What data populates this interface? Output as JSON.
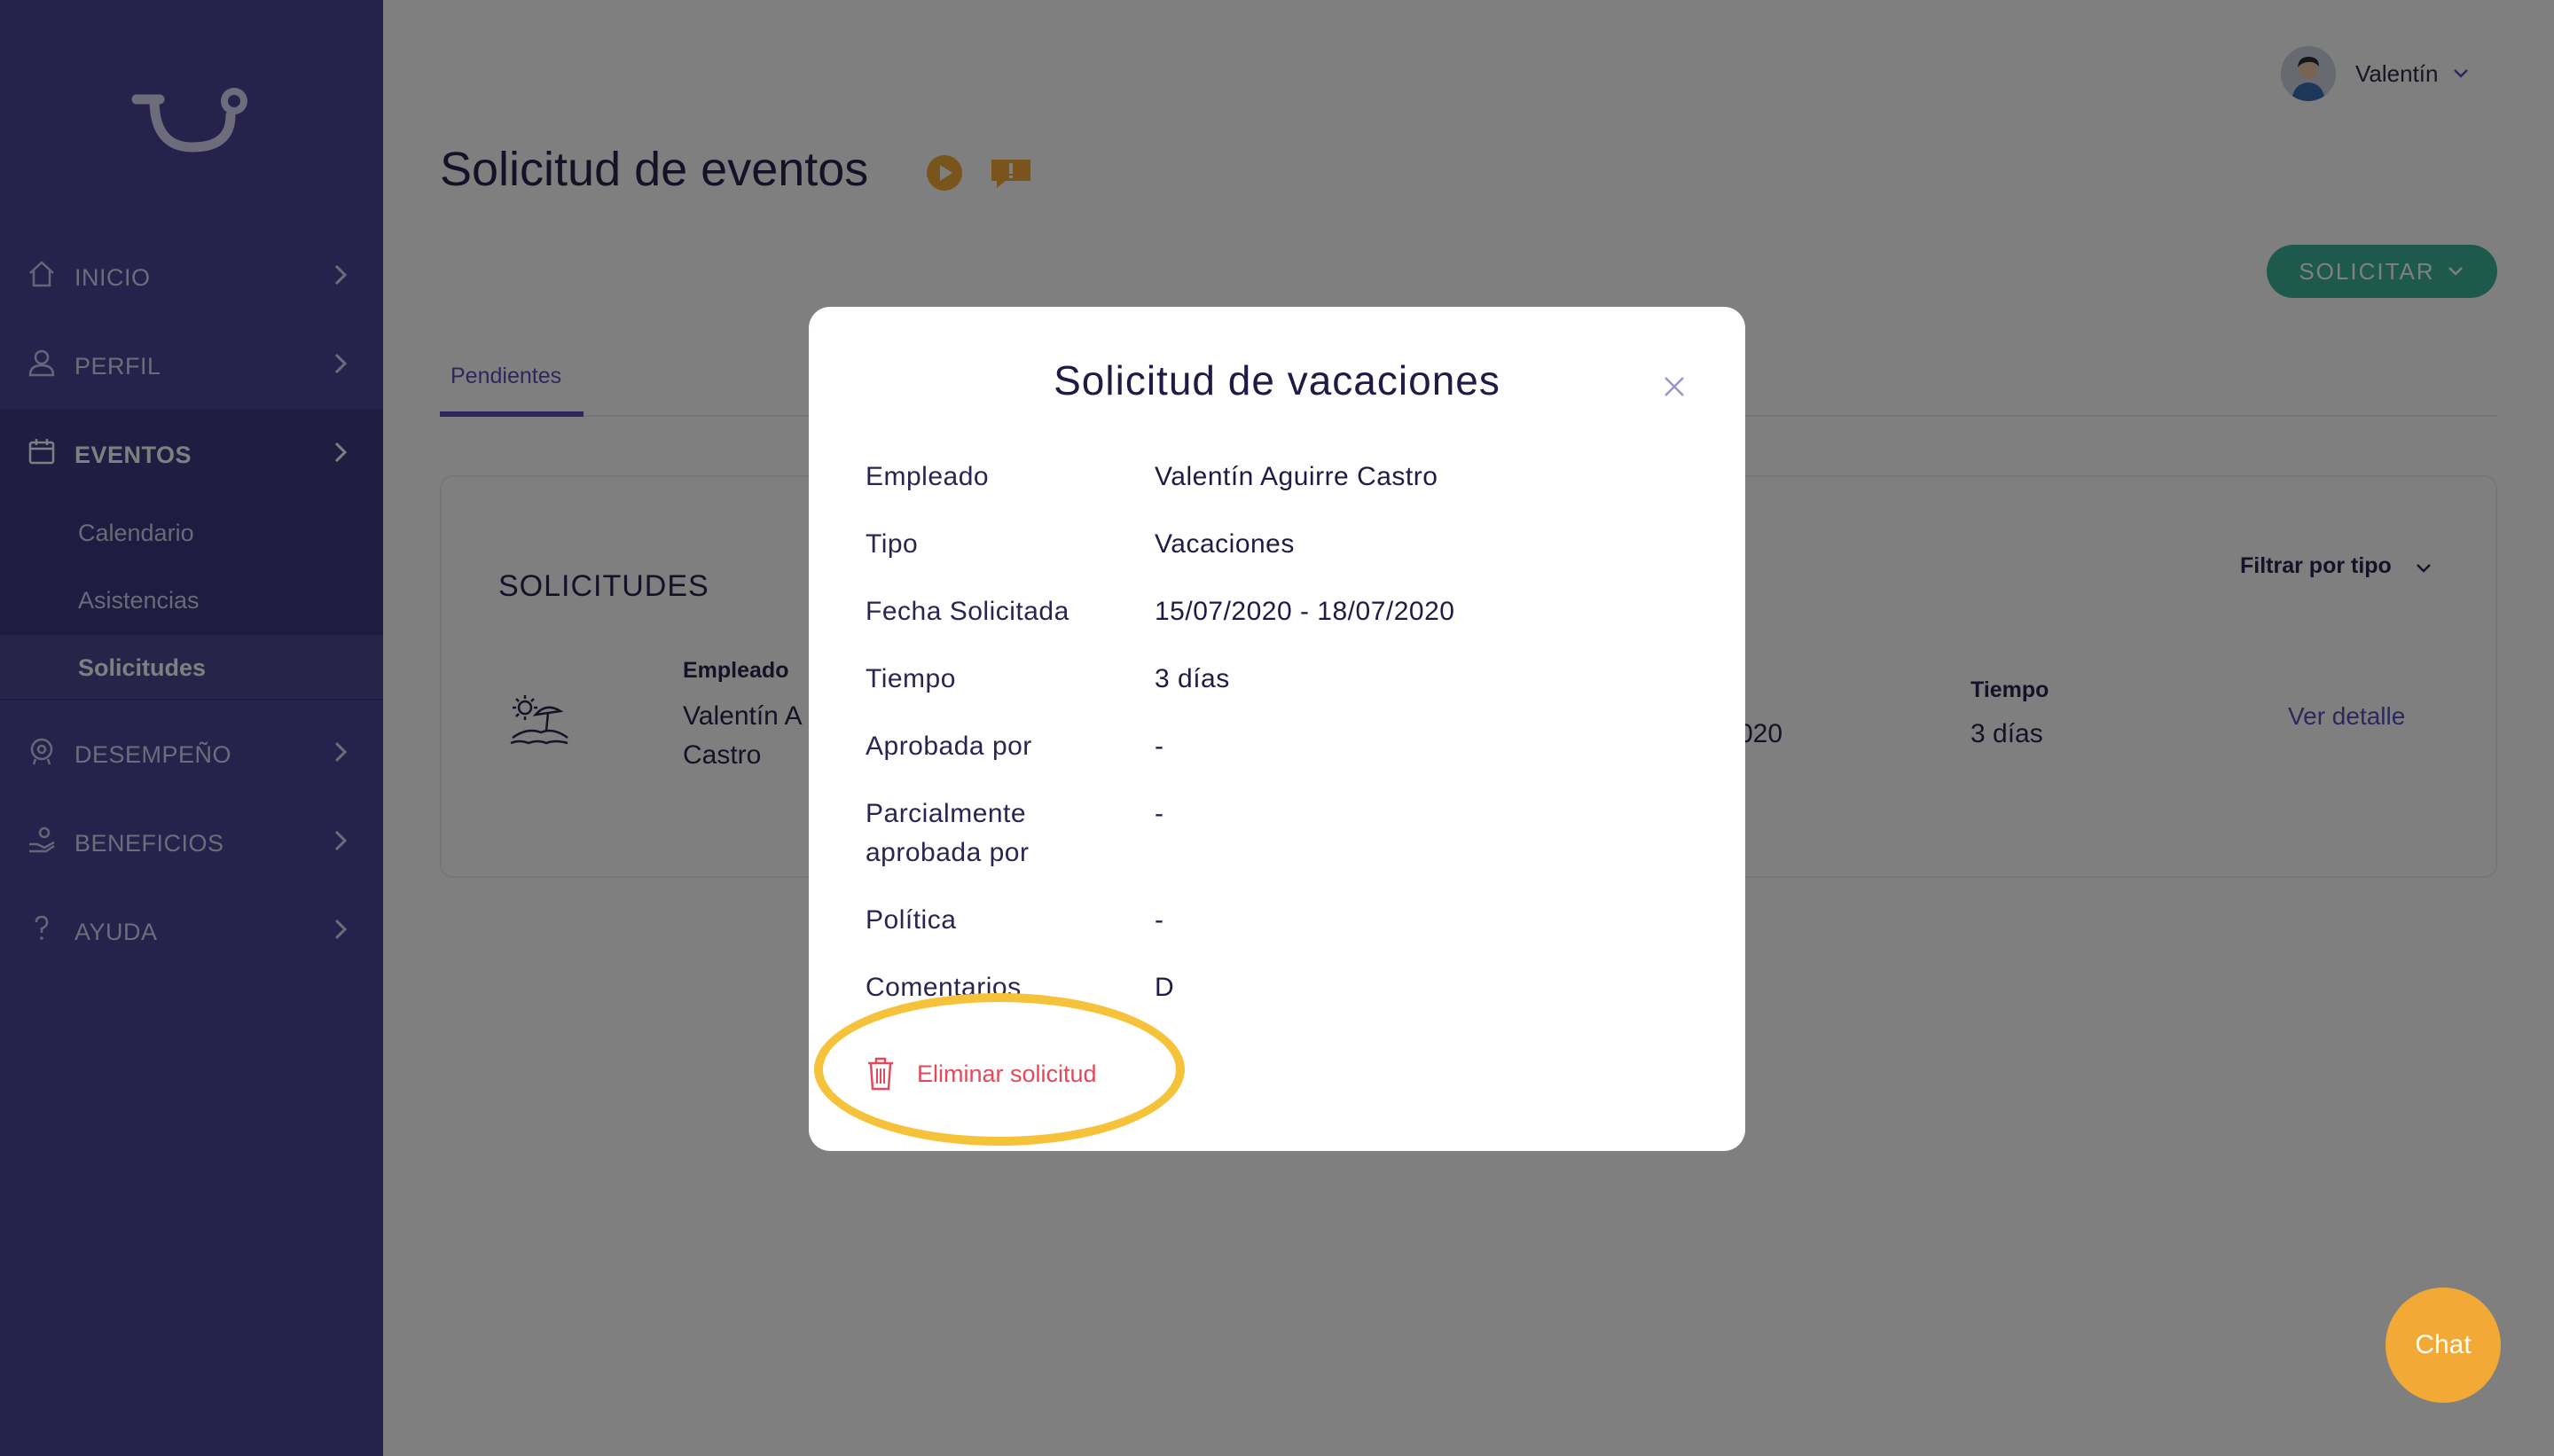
{
  "sidebar": {
    "items": [
      {
        "label": "INICIO",
        "icon": "home-icon"
      },
      {
        "label": "PERFIL",
        "icon": "user-icon"
      },
      {
        "label": "EVENTOS",
        "icon": "calendar-icon"
      },
      {
        "label": "DESEMPEÑO",
        "icon": "performance-icon"
      },
      {
        "label": "BENEFICIOS",
        "icon": "benefits-icon"
      },
      {
        "label": "AYUDA",
        "icon": "help-icon"
      }
    ],
    "eventos_sub": [
      "Calendario",
      "Asistencias",
      "Solicitudes"
    ]
  },
  "header": {
    "user_name": "Valentín",
    "page_title": "Solicitud de eventos",
    "solicitar_label": "SOLICITAR"
  },
  "tabs": [
    "Pendientes"
  ],
  "card": {
    "title": "SOLICITUDES",
    "filter_label": "Filtrar por tipo",
    "columns": {
      "empleado": "Empleado",
      "tiempo": "Tiempo"
    },
    "row": {
      "empleado_line1": "Valentín A",
      "empleado_line2": "Castro",
      "fecha_partial": "020",
      "tiempo": "3 días",
      "action": "Ver detalle"
    }
  },
  "modal": {
    "title": "Solicitud de vacaciones",
    "fields": [
      {
        "label": "Empleado",
        "value": "Valentín Aguirre Castro"
      },
      {
        "label": "Tipo",
        "value": "Vacaciones"
      },
      {
        "label": "Fecha Solicitada",
        "value": "15/07/2020 - 18/07/2020"
      },
      {
        "label": "Tiempo",
        "value": "3 días"
      },
      {
        "label": "Aprobada por",
        "value": "-"
      },
      {
        "label": "Parcialmente aprobada por",
        "value": "-"
      },
      {
        "label": "Política",
        "value": "-"
      },
      {
        "label": "Comentarios",
        "value": "D"
      }
    ],
    "delete_label": "Eliminar solicitud"
  },
  "chat": {
    "label": "Chat"
  },
  "colors": {
    "sidebar": "#4b4496",
    "accent": "#5a50b8",
    "solicitar": "#3bb39a",
    "danger": "#e5485a",
    "highlight": "#f5c23a",
    "chat": "#f2a936"
  }
}
